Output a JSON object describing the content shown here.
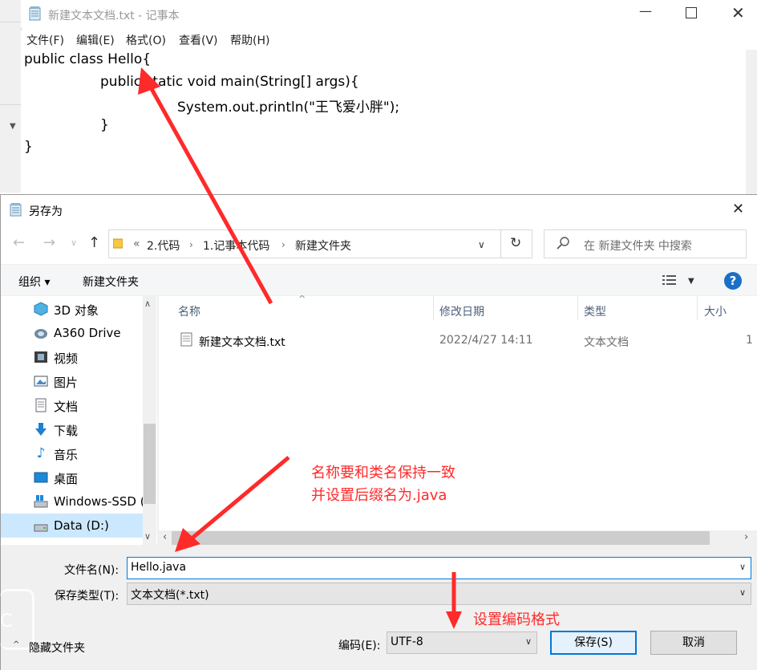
{
  "notepad": {
    "title": "新建文本文档.txt - 记事本",
    "menu": [
      "文件(F)",
      "编辑(E)",
      "格式(O)",
      "查看(V)",
      "帮助(H)"
    ],
    "code_lines": [
      "public class Hello{",
      "public static void main(String[] args){",
      "System.out.println(\"王飞爱小胖\");",
      "}",
      "}"
    ]
  },
  "dialog": {
    "title": "另存为",
    "breadcrumb": [
      "«",
      "2.代码",
      "1.记事本代码",
      "新建文件夹"
    ],
    "search_placeholder": "在 新建文件夹 中搜索",
    "toolbar": {
      "organize": "组织 ▾",
      "new_folder": "新建文件夹"
    },
    "tree": [
      "3D 对象",
      "A360 Drive",
      "视频",
      "图片",
      "文档",
      "下载",
      "音乐",
      "桌面",
      "Windows-SSD (",
      "Data (D:)"
    ],
    "columns": {
      "name": "名称",
      "modified": "修改日期",
      "type": "类型",
      "size": "大小"
    },
    "files": [
      {
        "name": "新建文本文档.txt",
        "modified": "2022/4/27 14:11",
        "type": "文本文档",
        "size": "1"
      }
    ],
    "filename_label": "文件名(N):",
    "filename_value": "Hello.java",
    "filetype_label": "保存类型(T):",
    "filetype_value": "文本文档(*.txt)",
    "hide_folders": "隐藏文件夹",
    "encoding_label": "编码(E):",
    "encoding_value": "UTF-8",
    "save_button": "保存(S)",
    "cancel_button": "取消"
  },
  "annotations": {
    "name_note_1": "名称要和类名保持一致",
    "name_note_2": "并设置后缀名为.java",
    "encoding_note": "设置编码格式"
  },
  "colors": {
    "annotation": "#ff2a2a",
    "accent": "#0078d7"
  }
}
